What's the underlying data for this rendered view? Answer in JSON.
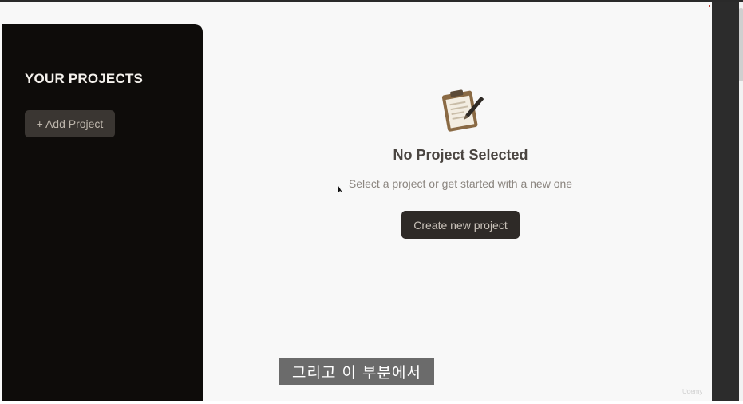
{
  "sidebar": {
    "title": "YOUR PROJECTS",
    "add_button_label": "+ Add Project"
  },
  "main": {
    "empty_icon": "clipboard-pen-icon",
    "title": "No Project Selected",
    "subtitle": "Select a project or get started with a new one",
    "create_button_label": "Create new project"
  },
  "overlay": {
    "caption": "그리고 이 부분에서",
    "watermark": "Udemy"
  },
  "colors": {
    "sidebar_bg": "#0e0c0a",
    "main_bg": "#f8f8f8",
    "button_bg": "#2e2a27",
    "add_button_bg": "#3a3632"
  }
}
